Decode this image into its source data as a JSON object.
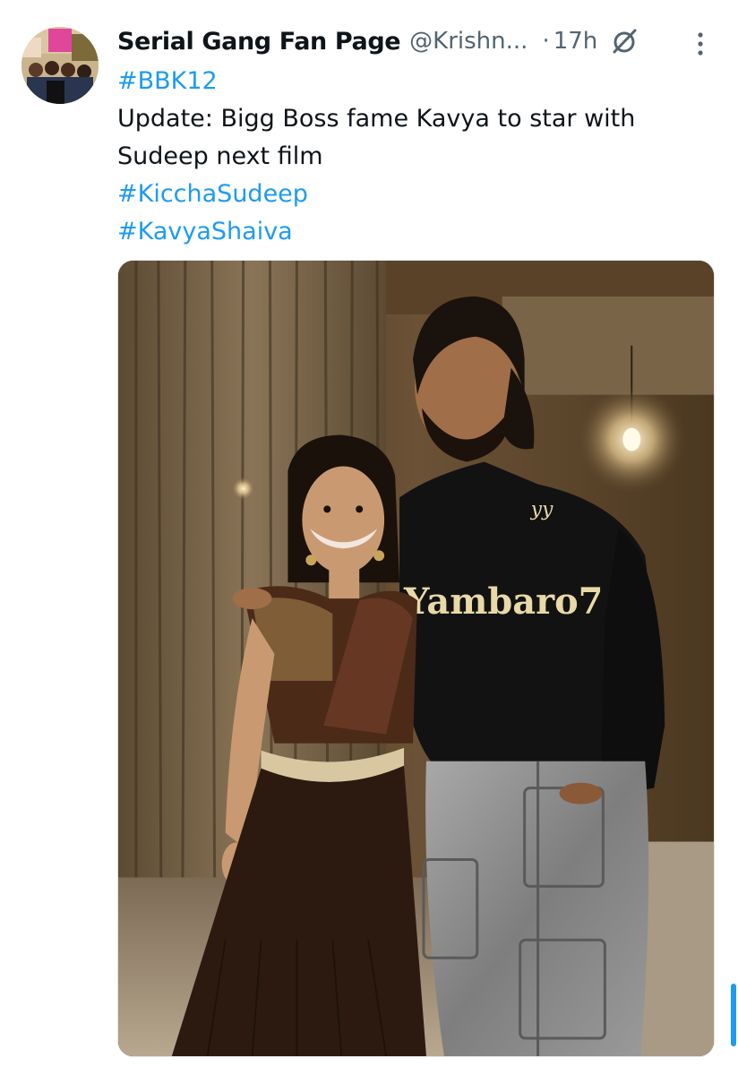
{
  "tweet": {
    "author_name": "Serial Gang Fan Page",
    "author_handle": "@Krishn...",
    "separator": "·",
    "timestamp": "17h",
    "lines": [
      {
        "text": "#BBK12",
        "type": "hashtag"
      },
      {
        "text": "Update: Bigg Boss fame Kavya to star with",
        "type": "text"
      },
      {
        "text": "Sudeep next film",
        "type": "text"
      },
      {
        "text": "#KicchaSudeep",
        "type": "hashtag"
      },
      {
        "text": "#KavyaShaiva",
        "type": "hashtag"
      }
    ],
    "photo": {
      "sweater_text": "Yambaro7",
      "logo_text": "yy"
    }
  },
  "icons": {
    "grok": "grok-icon",
    "more": "more-dots-icon"
  },
  "colors": {
    "accent": "#1d9bf0",
    "text_primary": "#0f1419",
    "text_secondary": "#536471"
  }
}
